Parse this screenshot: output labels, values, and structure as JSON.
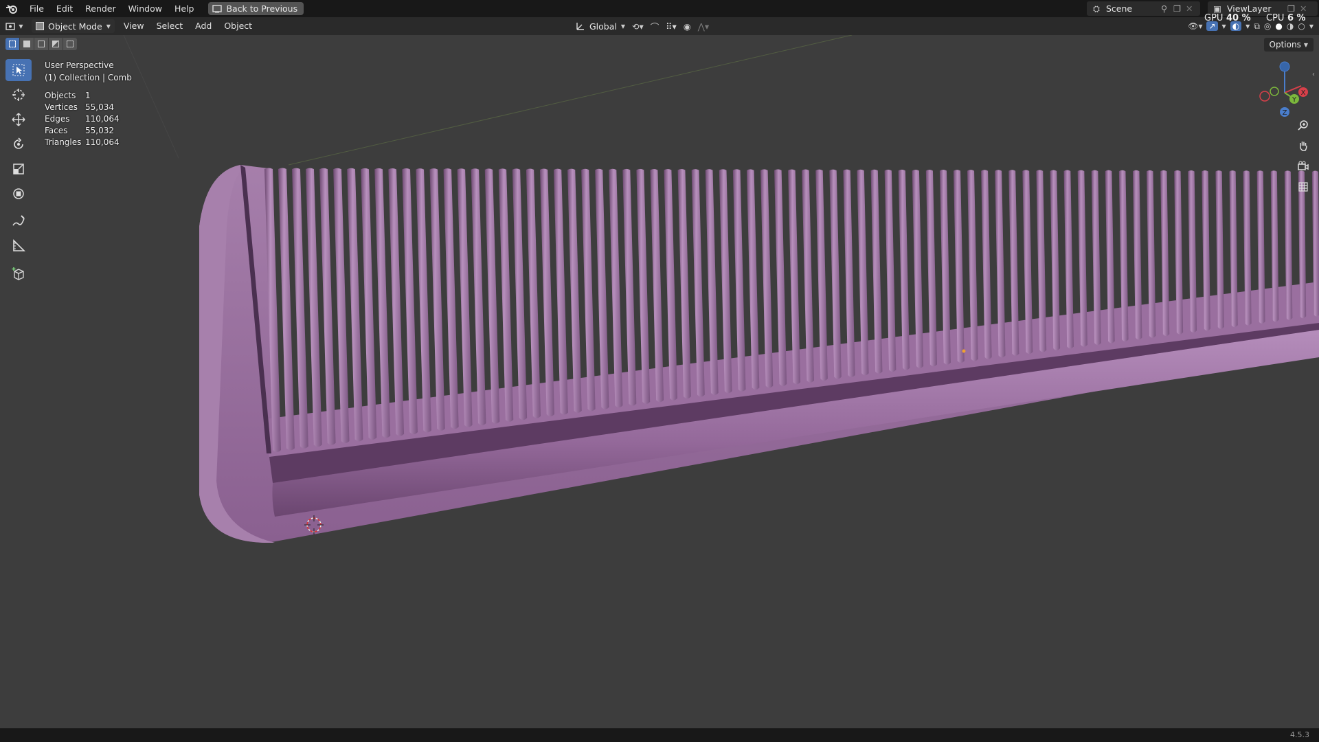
{
  "menu": {
    "items": [
      "File",
      "Edit",
      "Render",
      "Window",
      "Help"
    ],
    "back_button": "Back to Previous"
  },
  "scene": {
    "name": "Scene",
    "view_layer": "ViewLayer"
  },
  "performance": {
    "gpu_label": "GPU",
    "gpu_value": "40 %",
    "cpu_label": "CPU",
    "cpu_value": "6 %"
  },
  "header": {
    "mode": "Object Mode",
    "menus": [
      "View",
      "Select",
      "Add",
      "Object"
    ],
    "transform_orientation": "Global",
    "options": "Options"
  },
  "viewport": {
    "perspective": "User Perspective",
    "collection": "(1) Collection | Comb",
    "stats": [
      {
        "label": "Objects",
        "value": "1"
      },
      {
        "label": "Vertices",
        "value": "55,034"
      },
      {
        "label": "Edges",
        "value": "110,064"
      },
      {
        "label": "Faces",
        "value": "55,032"
      },
      {
        "label": "Triangles",
        "value": "110,064"
      }
    ]
  },
  "gizmo": {
    "x": "X",
    "y": "Y",
    "z": "Z"
  },
  "status": {
    "version": "4.5.3"
  },
  "colors": {
    "accent": "#4772b3",
    "comb": "#9a6f9e",
    "background": "#3d3d3d"
  }
}
